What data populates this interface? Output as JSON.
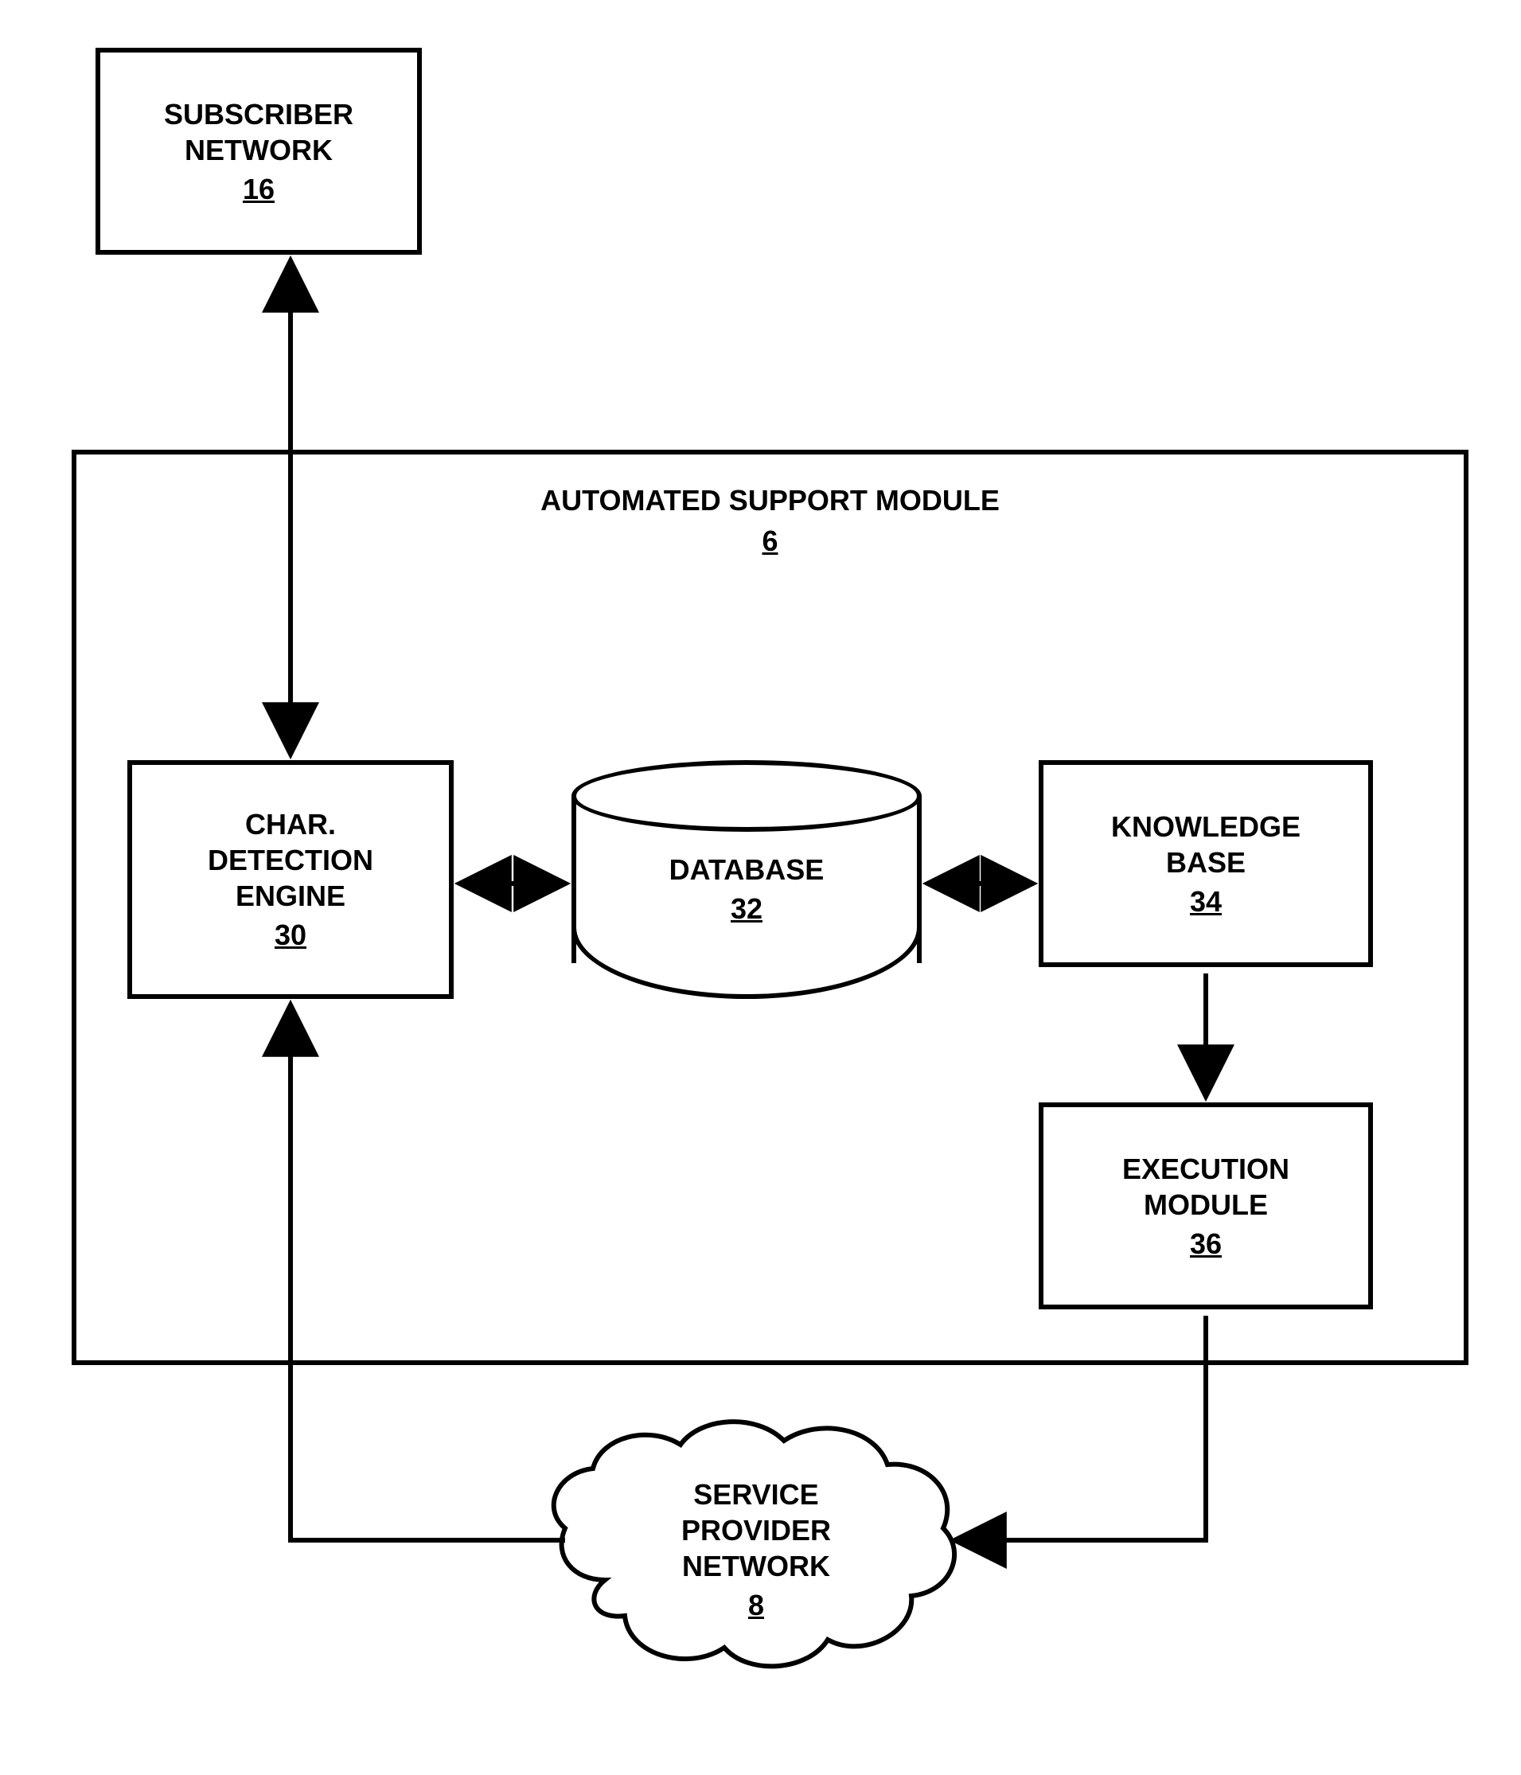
{
  "blocks": {
    "subscriber_network": {
      "label": "SUBSCRIBER NETWORK",
      "ref": "16"
    },
    "automated_support_module": {
      "label": "AUTOMATED SUPPORT MODULE",
      "ref": "6"
    },
    "char_detection_engine": {
      "label_l1": "CHAR.",
      "label_l2": "DETECTION",
      "label_l3": "ENGINE",
      "ref": "30"
    },
    "database": {
      "label": "DATABASE",
      "ref": "32"
    },
    "knowledge_base": {
      "label_l1": "KNOWLEDGE",
      "label_l2": "BASE",
      "ref": "34"
    },
    "execution_module": {
      "label_l1": "EXECUTION",
      "label_l2": "MODULE",
      "ref": "36"
    },
    "service_provider_network": {
      "label_l1": "SERVICE",
      "label_l2": "PROVIDER",
      "label_l3": "NETWORK",
      "ref": "8"
    }
  },
  "connections": [
    {
      "from": "subscriber_network",
      "to": "char_detection_engine",
      "type": "bidirectional"
    },
    {
      "from": "char_detection_engine",
      "to": "database",
      "type": "bidirectional"
    },
    {
      "from": "database",
      "to": "knowledge_base",
      "type": "bidirectional"
    },
    {
      "from": "knowledge_base",
      "to": "execution_module",
      "type": "unidirectional"
    },
    {
      "from": "execution_module",
      "to": "service_provider_network",
      "type": "unidirectional"
    },
    {
      "from": "service_provider_network",
      "to": "char_detection_engine",
      "type": "unidirectional"
    }
  ]
}
